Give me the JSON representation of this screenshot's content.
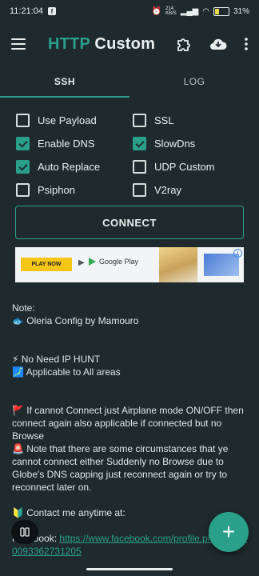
{
  "status_bar": {
    "time": "11:21:04",
    "fb_badge": "f",
    "network": "214\nKB/S",
    "battery": "31%",
    "battery_level_pct": 31
  },
  "app_bar": {
    "title_part1": "HTTP",
    "title_part2": "Custom",
    "icons": [
      "menu-icon",
      "puzzle-icon",
      "cloud-download-icon",
      "more-vert-icon"
    ]
  },
  "tabs": [
    {
      "label": "SSH",
      "active": true
    },
    {
      "label": "LOG",
      "active": false
    }
  ],
  "options": [
    {
      "label": "Use Payload",
      "checked": false
    },
    {
      "label": "SSL",
      "checked": false
    },
    {
      "label": "Enable DNS",
      "checked": true
    },
    {
      "label": "SlowDns",
      "checked": true
    },
    {
      "label": "Auto Replace",
      "checked": true
    },
    {
      "label": "UDP Custom",
      "checked": false
    },
    {
      "label": "Psiphon",
      "checked": false
    },
    {
      "label": "V2ray",
      "checked": false
    }
  ],
  "connect_label": "CONNECT",
  "ad": {
    "cta": "PLAY NOW",
    "store": "Google Play",
    "info": "i"
  },
  "note": {
    "heading": "Note:",
    "line1": "🐟 Oleria Config by Mamouro",
    "line2": "⚡ No Need IP HUNT",
    "line3": "🗾 Applicable to All areas",
    "line4": "🚩 If cannot Connect just Airplane mode ON/OFF then connect again also applicable if connected but no Browse",
    "line5": "🚨 Note that there are some circumstances that ye cannot connect either Suddenly no Browse due to Globe's DNS capping just reconnect again or try to reconnect later on.",
    "line6": "🔰 Contact me anytime at:",
    "facebook_label": "Facebook:",
    "facebook_link": "https://www.facebook.com/profile.php?id=100093362731205"
  },
  "colors": {
    "accent": "#2aa08a",
    "background": "#1f2a2e"
  }
}
